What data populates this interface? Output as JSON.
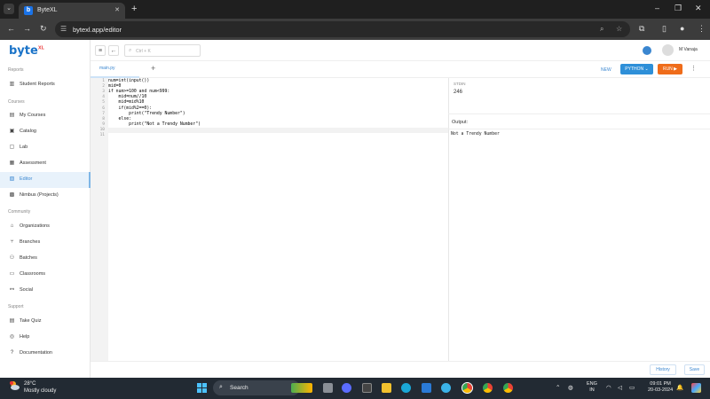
{
  "browser": {
    "tab_title": "ByteXL",
    "tab_favicon": "b",
    "url": "bytexl.app/editor"
  },
  "app": {
    "logo_text": "byte",
    "logo_sup": "XL",
    "search_placeholder": "Ctrl + K",
    "user_name": "M Vanaja"
  },
  "sidebar": {
    "sections": {
      "reports": "Reports",
      "courses": "Courses",
      "community": "Community",
      "support": "Support"
    },
    "items": [
      {
        "label": "Student Reports",
        "icon": "chart-icon"
      },
      {
        "label": "My Courses",
        "icon": "book-icon"
      },
      {
        "label": "Catalog",
        "icon": "catalog-icon"
      },
      {
        "label": "Lab",
        "icon": "lab-icon"
      },
      {
        "label": "Assessment",
        "icon": "assessment-icon"
      },
      {
        "label": "Editor",
        "icon": "editor-icon"
      },
      {
        "label": "Nimbus (Projects)",
        "icon": "projects-icon"
      },
      {
        "label": "Organizations",
        "icon": "org-icon"
      },
      {
        "label": "Branches",
        "icon": "branch-icon"
      },
      {
        "label": "Batches",
        "icon": "batch-icon"
      },
      {
        "label": "Classrooms",
        "icon": "classroom-icon"
      },
      {
        "label": "Social",
        "icon": "social-icon"
      },
      {
        "label": "Take Quiz",
        "icon": "quiz-icon"
      },
      {
        "label": "Help",
        "icon": "help-icon"
      },
      {
        "label": "Documentation",
        "icon": "doc-icon"
      }
    ]
  },
  "editor": {
    "file_tab": "main.py",
    "new_label": "NEW",
    "language": "PYTHON",
    "run_label": "RUN",
    "line_numbers": [
      "1",
      "2",
      "3",
      "4",
      "5",
      "6",
      "7",
      "8",
      "9",
      "10",
      "11"
    ],
    "lines": [
      "num=int(input())",
      "mid=0",
      "if num>=100 and num<999:",
      "    mid=num//10",
      "    mid=mid%10",
      "    if(mid%2==0):",
      "        print(\"Trendy Number\")",
      "    else:",
      "        print(\"Not a Trendy Number\")",
      "",
      ""
    ]
  },
  "io": {
    "stdin_label": "STDIN",
    "stdin_value": "246",
    "output_label": "Output:",
    "output_text": "Not a Trendy Number"
  },
  "footer": {
    "history_label": "History",
    "save_label": "Save"
  },
  "taskbar": {
    "temperature": "28°C",
    "condition": "Mostly cloudy",
    "search_label": "Search",
    "lang_1": "ENG",
    "lang_2": "IN",
    "time": "09:01 PM",
    "date": "20-03-2024"
  },
  "colors": {
    "accent": "#3a86d0",
    "run": "#ef6c1a",
    "python": "#2e8fd8"
  }
}
